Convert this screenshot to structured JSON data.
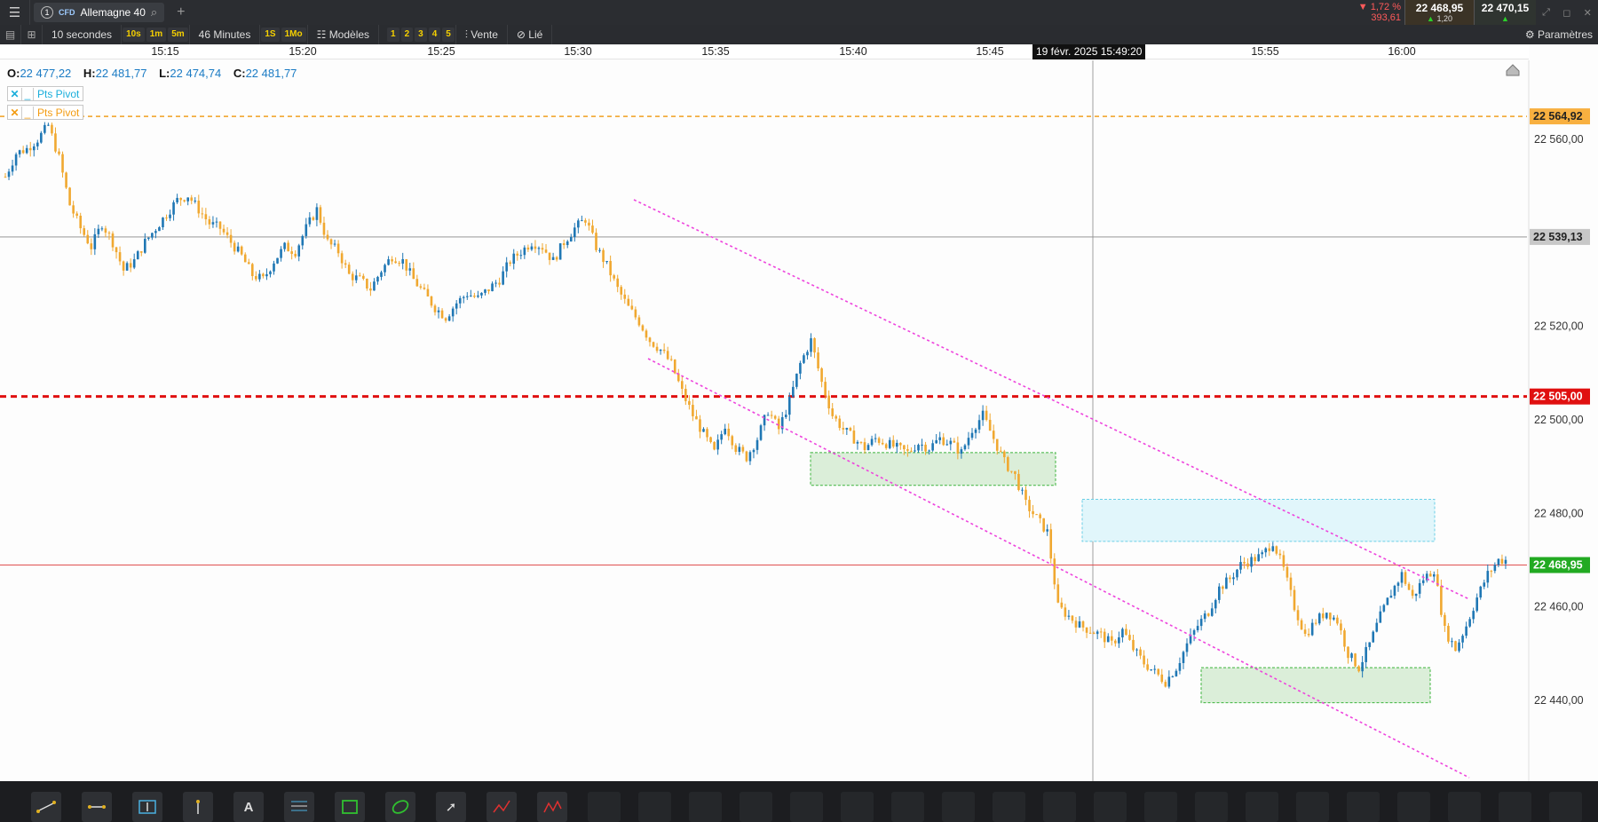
{
  "header": {
    "tab_number": "1",
    "tab_type": "CFD",
    "instrument": "Allemagne 40",
    "change_pct": "▼ 1,72 %",
    "change_pts": "393,61",
    "sell_price": "22 468,95",
    "spread": "1,20",
    "buy_price": "22 470,15"
  },
  "toolbar": {
    "interval": "10 secondes",
    "quick_intervals": [
      "10s",
      "1m",
      "5m"
    ],
    "range": "46 Minutes",
    "quick_ranges": [
      "1S",
      "1Mo"
    ],
    "models_label": "Modèles",
    "layouts": [
      "1",
      "2",
      "3",
      "4",
      "5"
    ],
    "side_label": "Vente",
    "link_label": "Lié",
    "settings_label": "Paramètres"
  },
  "time_axis": {
    "labels": [
      "15:15",
      "15:20",
      "15:25",
      "15:30",
      "15:35",
      "15:40",
      "15:45",
      "15:55",
      "16:00"
    ],
    "cursor_label": "19 févr. 2025 15:49:20"
  },
  "ohlc": {
    "o_label": "O:",
    "o": "22 477,22",
    "h_label": "H:",
    "h": "22 481,77",
    "l_label": "L:",
    "l": "22 474,74",
    "c_label": "C:",
    "c": "22 481,77"
  },
  "indicators": [
    {
      "label": "Pts Pivot",
      "color": "#1aaedb"
    },
    {
      "label": "Pts Pivot",
      "color": "#f39c12"
    }
  ],
  "price_axis": {
    "ticks": [
      "22 560,00",
      "22 520,00",
      "22 500,00",
      "22 480,00",
      "22 460,00",
      "22 440,00"
    ],
    "pivot_level": "22 564,92",
    "crosshair_level": "22 539,13",
    "red_level": "22 505,00",
    "last_price": "22 468,95"
  },
  "colors": {
    "up_candle": "#1f77b4",
    "down_candle": "#f0a830",
    "red_level": "#e01010",
    "pivot_line": "#f0a020",
    "channel": "#ee44dd",
    "zone_green": "#dbeed9",
    "zone_cyan": "#e1f6fb",
    "last_price_bg": "#22aa22"
  },
  "chart_data": {
    "type": "candlestick",
    "y_range": [
      22422,
      22574
    ],
    "x_range": [
      "15:12:30",
      "16:06:00"
    ],
    "close_path": [
      [
        0,
        22552
      ],
      [
        3,
        22557
      ],
      [
        6,
        22558
      ],
      [
        9,
        22560
      ],
      [
        12,
        22563
      ],
      [
        15,
        22556
      ],
      [
        18,
        22546
      ],
      [
        21,
        22541
      ],
      [
        24,
        22537
      ],
      [
        27,
        22542
      ],
      [
        30,
        22538
      ],
      [
        33,
        22532
      ],
      [
        36,
        22534
      ],
      [
        39,
        22538
      ],
      [
        42,
        22541
      ],
      [
        45,
        22544
      ],
      [
        48,
        22547
      ],
      [
        51,
        22548
      ],
      [
        54,
        22545
      ],
      [
        57,
        22542
      ],
      [
        60,
        22541
      ],
      [
        63,
        22538
      ],
      [
        66,
        22535
      ],
      [
        69,
        22531
      ],
      [
        72,
        22530
      ],
      [
        75,
        22534
      ],
      [
        78,
        22537
      ],
      [
        81,
        22536
      ],
      [
        84,
        22541
      ],
      [
        87,
        22545
      ],
      [
        90,
        22538
      ],
      [
        93,
        22536
      ],
      [
        96,
        22531
      ],
      [
        99,
        22530
      ],
      [
        102,
        22528
      ],
      [
        105,
        22532
      ],
      [
        108,
        22535
      ],
      [
        111,
        22534
      ],
      [
        114,
        22530
      ],
      [
        117,
        22527
      ],
      [
        120,
        22524
      ],
      [
        123,
        22522
      ],
      [
        126,
        22525
      ],
      [
        129,
        22527
      ],
      [
        132,
        22526
      ],
      [
        135,
        22528
      ],
      [
        138,
        22530
      ],
      [
        141,
        22534
      ],
      [
        144,
        22536
      ],
      [
        147,
        22538
      ],
      [
        150,
        22537
      ],
      [
        153,
        22534
      ],
      [
        156,
        22538
      ],
      [
        159,
        22541
      ],
      [
        162,
        22543
      ],
      [
        165,
        22537
      ],
      [
        168,
        22533
      ],
      [
        171,
        22528
      ],
      [
        174,
        22524
      ],
      [
        177,
        22521
      ],
      [
        180,
        22517
      ],
      [
        183,
        22515
      ],
      [
        186,
        22512
      ],
      [
        189,
        22506
      ],
      [
        192,
        22501
      ],
      [
        195,
        22497
      ],
      [
        198,
        22493
      ],
      [
        201,
        22499
      ],
      [
        204,
        22494
      ],
      [
        207,
        22492
      ],
      [
        210,
        22496
      ],
      [
        213,
        22502
      ],
      [
        216,
        22498
      ],
      [
        219,
        22504
      ],
      [
        222,
        22512
      ],
      [
        225,
        22517
      ],
      [
        228,
        22508
      ],
      [
        231,
        22501
      ],
      [
        234,
        22498
      ],
      [
        237,
        22496
      ],
      [
        240,
        22494
      ],
      [
        243,
        22496
      ],
      [
        246,
        22495
      ],
      [
        249,
        22494
      ],
      [
        252,
        22493
      ],
      [
        255,
        22495
      ],
      [
        258,
        22494
      ],
      [
        261,
        22496
      ],
      [
        264,
        22495
      ],
      [
        267,
        22493
      ],
      [
        270,
        22498
      ],
      [
        273,
        22501
      ],
      [
        276,
        22496
      ],
      [
        279,
        22491
      ],
      [
        282,
        22488
      ],
      [
        285,
        22482
      ],
      [
        288,
        22479
      ],
      [
        291,
        22476
      ],
      [
        294,
        22460
      ],
      [
        297,
        22458
      ],
      [
        300,
        22456
      ],
      [
        303,
        22455
      ],
      [
        306,
        22454
      ],
      [
        309,
        22452
      ],
      [
        312,
        22455
      ],
      [
        315,
        22451
      ],
      [
        318,
        22448
      ],
      [
        321,
        22446
      ],
      [
        324,
        22444
      ],
      [
        327,
        22447
      ],
      [
        330,
        22452
      ],
      [
        333,
        22456
      ],
      [
        336,
        22459
      ],
      [
        339,
        22464
      ],
      [
        342,
        22466
      ],
      [
        345,
        22469
      ],
      [
        348,
        22470
      ],
      [
        351,
        22471
      ],
      [
        354,
        22474
      ],
      [
        357,
        22468
      ],
      [
        360,
        22460
      ],
      [
        363,
        22454
      ],
      [
        366,
        22457
      ],
      [
        369,
        22459
      ],
      [
        372,
        22457
      ],
      [
        375,
        22450
      ],
      [
        378,
        22447
      ],
      [
        381,
        22452
      ],
      [
        384,
        22458
      ],
      [
        387,
        22463
      ],
      [
        390,
        22467
      ],
      [
        393,
        22462
      ],
      [
        396,
        22466
      ],
      [
        399,
        22468
      ],
      [
        402,
        22455
      ],
      [
        405,
        22451
      ],
      [
        408,
        22456
      ],
      [
        411,
        22462
      ],
      [
        414,
        22467
      ],
      [
        417,
        22470
      ]
    ]
  }
}
